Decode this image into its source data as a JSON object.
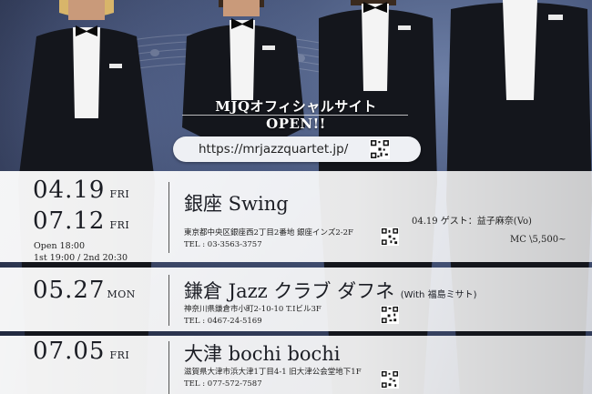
{
  "banner": {
    "title": "MJQオフィシャルサイトOPEN!!"
  },
  "site": {
    "url": "https://mrjazzquartet.jp/"
  },
  "events": [
    {
      "dates": [
        {
          "date": "04.19",
          "dow": "FRI"
        },
        {
          "date": "07.12",
          "dow": "FRI"
        }
      ],
      "time_line1": "Open 18:00",
      "time_line2": "1st 19:00 / 2nd 20:30",
      "venue": "銀座 Swing",
      "address": "東京都中央区銀座西2丁目2番地 銀座インズ2-2F",
      "tel": "TEL : 03-3563-3757",
      "guest": "04.19 ゲスト：益子麻奈(Vo)",
      "charge": "MC \\5,500~"
    },
    {
      "dates": [
        {
          "date": "05.27",
          "dow": "MON"
        }
      ],
      "venue": "鎌倉 Jazz クラブ ダフネ",
      "venue_note": "(With 福島ミサト)",
      "address": "神奈川県鎌倉市小町2-10-10 T.Iビル3F",
      "tel": "TEL : 0467-24-5169"
    },
    {
      "dates": [
        {
          "date": "07.05",
          "dow": "FRI"
        }
      ],
      "venue": "大津 bochi bochi",
      "address": "滋賀県大津市浜大津1丁目4-1 旧大津公会堂地下1F",
      "tel": "TEL : 077-572-7587"
    }
  ],
  "colors": {
    "panel": "#ffffff",
    "text": "#1b1d24",
    "background": "#2f3a52"
  },
  "icons": [
    "qr-code-icon"
  ]
}
